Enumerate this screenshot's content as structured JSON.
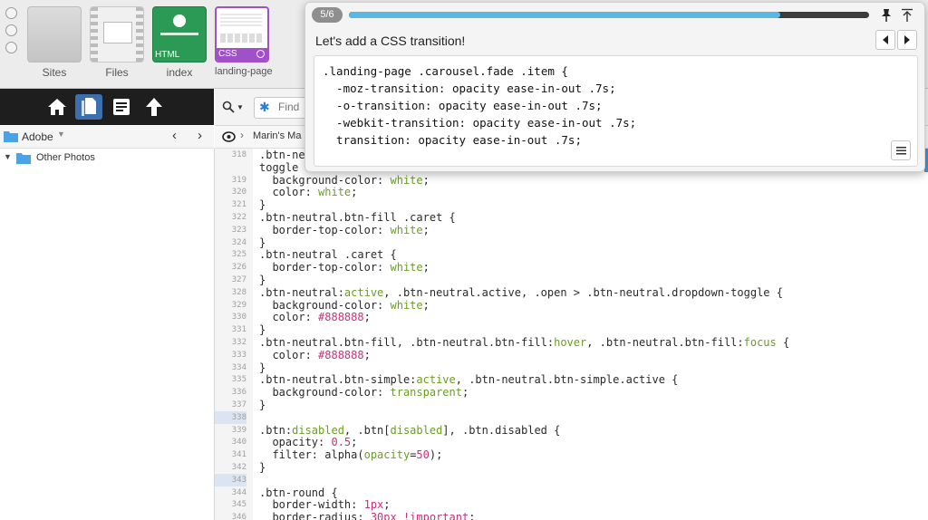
{
  "window_controls": [
    "close",
    "minimize",
    "zoom"
  ],
  "thumbnails": [
    {
      "label": "Sites",
      "tag": "",
      "kind": "sites"
    },
    {
      "label": "Files",
      "tag": "",
      "kind": "files"
    },
    {
      "label": "index",
      "tag": "HTML",
      "kind": "html"
    },
    {
      "label": "landing-page",
      "tag": "CSS",
      "kind": "css"
    }
  ],
  "nav_icons": [
    "home-icon",
    "files-icon",
    "notes-icon",
    "upload-icon"
  ],
  "search": {
    "placeholder": "Find",
    "icon": "magnifier-icon"
  },
  "sidebar": {
    "location": "Adobe",
    "tree_items": [
      {
        "label": "Other Photos",
        "icon": "folder-icon",
        "expanded": true
      }
    ]
  },
  "breadcrumb": {
    "text": "Marin's Ma"
  },
  "tutorial": {
    "step": "5/6",
    "progress": 0.83,
    "title": "Let's add a CSS transition!",
    "snippet_lines": [
      ".landing-page .carousel.fade .item {",
      "  -moz-transition: opacity ease-in-out .7s;",
      "  -o-transition: opacity ease-in-out .7s;",
      "  -webkit-transition: opacity ease-in-out .7s;",
      "  transition: opacity ease-in-out .7s;"
    ],
    "icons": [
      "pin-icon",
      "collapse-icon",
      "prev-arrow-icon",
      "next-arrow-icon",
      "menu-icon"
    ]
  },
  "colors": {
    "accent_blue": "#2d7fd3",
    "progress_fill": "#5bb8e0",
    "html_tile": "#2a9a55",
    "css_tile_border": "#a050c8",
    "value_green": "#6a9e1f",
    "value_pink": "#c5307a"
  },
  "code": {
    "lines": [
      {
        "n": "318",
        "parts": [
          {
            "t": ".btn-neu",
            "c": "sel"
          }
        ]
      },
      {
        "n": "",
        "parts": [
          {
            "t": "toggle",
            "c": "sel"
          }
        ]
      },
      {
        "n": "319",
        "parts": [
          {
            "t": "  background-color: ",
            "c": "prop"
          },
          {
            "t": "white",
            "c": "val"
          },
          {
            "t": ";",
            "c": "p"
          }
        ]
      },
      {
        "n": "320",
        "parts": [
          {
            "t": "  color: ",
            "c": "prop"
          },
          {
            "t": "white",
            "c": "val"
          },
          {
            "t": ";",
            "c": "p"
          }
        ]
      },
      {
        "n": "321",
        "parts": [
          {
            "t": "}",
            "c": "p"
          }
        ]
      },
      {
        "n": "322",
        "parts": [
          {
            "t": ".btn-neutral.btn-fill .caret {",
            "c": "sel"
          }
        ]
      },
      {
        "n": "323",
        "parts": [
          {
            "t": "  border-top-color: ",
            "c": "prop"
          },
          {
            "t": "white",
            "c": "val"
          },
          {
            "t": ";",
            "c": "p"
          }
        ]
      },
      {
        "n": "324",
        "parts": [
          {
            "t": "}",
            "c": "p"
          }
        ]
      },
      {
        "n": "325",
        "parts": [
          {
            "t": ".btn-neutral .caret {",
            "c": "sel"
          }
        ]
      },
      {
        "n": "326",
        "parts": [
          {
            "t": "  border-top-color: ",
            "c": "prop"
          },
          {
            "t": "white",
            "c": "val"
          },
          {
            "t": ";",
            "c": "p"
          }
        ]
      },
      {
        "n": "327",
        "parts": [
          {
            "t": "}",
            "c": "p"
          }
        ]
      },
      {
        "n": "328",
        "parts": [
          {
            "t": ".btn-neutral:",
            "c": "sel"
          },
          {
            "t": "active",
            "c": "val"
          },
          {
            "t": ", .btn-neutral.active, .open > .btn-neutral.dropdown-toggle {",
            "c": "sel"
          }
        ]
      },
      {
        "n": "329",
        "parts": [
          {
            "t": "  background-color: ",
            "c": "prop"
          },
          {
            "t": "white",
            "c": "val"
          },
          {
            "t": ";",
            "c": "p"
          }
        ]
      },
      {
        "n": "330",
        "parts": [
          {
            "t": "  color: ",
            "c": "prop"
          },
          {
            "t": "#888888",
            "c": "num"
          },
          {
            "t": ";",
            "c": "p"
          }
        ]
      },
      {
        "n": "331",
        "parts": [
          {
            "t": "}",
            "c": "p"
          }
        ]
      },
      {
        "n": "332",
        "parts": [
          {
            "t": ".btn-neutral.btn-fill, .btn-neutral.btn-fill:",
            "c": "sel"
          },
          {
            "t": "hover",
            "c": "val"
          },
          {
            "t": ", .btn-neutral.btn-fill:",
            "c": "sel"
          },
          {
            "t": "focus",
            "c": "val"
          },
          {
            "t": " {",
            "c": "sel"
          }
        ]
      },
      {
        "n": "333",
        "parts": [
          {
            "t": "  color: ",
            "c": "prop"
          },
          {
            "t": "#888888",
            "c": "num"
          },
          {
            "t": ";",
            "c": "p"
          }
        ]
      },
      {
        "n": "334",
        "parts": [
          {
            "t": "}",
            "c": "p"
          }
        ]
      },
      {
        "n": "335",
        "parts": [
          {
            "t": ".btn-neutral.btn-simple:",
            "c": "sel"
          },
          {
            "t": "active",
            "c": "val"
          },
          {
            "t": ", .btn-neutral.btn-simple.active {",
            "c": "sel"
          }
        ]
      },
      {
        "n": "336",
        "parts": [
          {
            "t": "  background-color: ",
            "c": "prop"
          },
          {
            "t": "transparent",
            "c": "val"
          },
          {
            "t": ";",
            "c": "p"
          }
        ]
      },
      {
        "n": "337",
        "parts": [
          {
            "t": "}",
            "c": "p"
          }
        ]
      },
      {
        "n": "338",
        "parts": [],
        "mark": true
      },
      {
        "n": "339",
        "parts": [
          {
            "t": ".btn:",
            "c": "sel"
          },
          {
            "t": "disabled",
            "c": "val"
          },
          {
            "t": ", .btn[",
            "c": "sel"
          },
          {
            "t": "disabled",
            "c": "val"
          },
          {
            "t": "], .btn.disabled {",
            "c": "sel"
          }
        ]
      },
      {
        "n": "340",
        "parts": [
          {
            "t": "  opacity: ",
            "c": "prop"
          },
          {
            "t": "0.5",
            "c": "num"
          },
          {
            "t": ";",
            "c": "p"
          }
        ]
      },
      {
        "n": "341",
        "parts": [
          {
            "t": "  filter: ",
            "c": "prop"
          },
          {
            "t": "alpha(",
            "c": "p"
          },
          {
            "t": "opacity",
            "c": "val"
          },
          {
            "t": "=",
            "c": "p"
          },
          {
            "t": "50",
            "c": "num"
          },
          {
            "t": ");",
            "c": "p"
          }
        ]
      },
      {
        "n": "342",
        "parts": [
          {
            "t": "}",
            "c": "p"
          }
        ]
      },
      {
        "n": "343",
        "parts": [],
        "mark": true
      },
      {
        "n": "344",
        "parts": [
          {
            "t": ".btn-round {",
            "c": "sel"
          }
        ]
      },
      {
        "n": "345",
        "parts": [
          {
            "t": "  border-width: ",
            "c": "prop"
          },
          {
            "t": "1px",
            "c": "num"
          },
          {
            "t": ";",
            "c": "p"
          }
        ]
      },
      {
        "n": "346",
        "parts": [
          {
            "t": "  border-radius: ",
            "c": "prop"
          },
          {
            "t": "30px !important",
            "c": "num"
          },
          {
            "t": ";",
            "c": "p"
          }
        ]
      }
    ]
  }
}
